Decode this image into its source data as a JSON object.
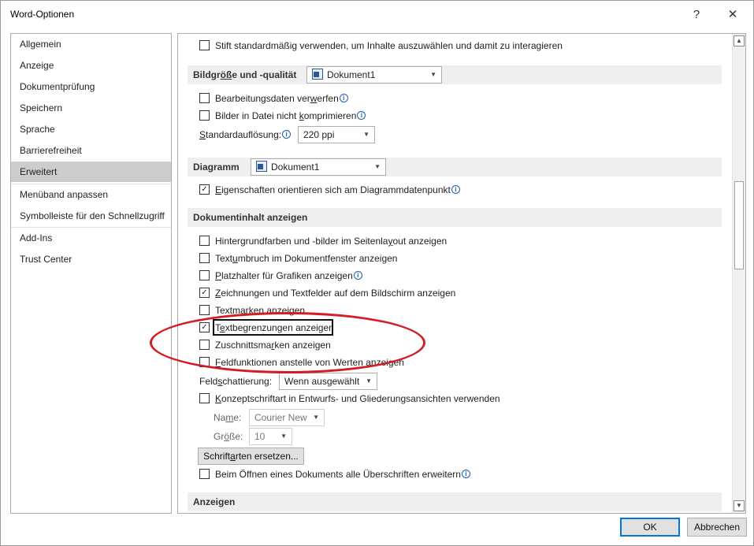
{
  "window": {
    "title": "Word-Optionen",
    "help_glyph": "?",
    "close_glyph": "✕"
  },
  "nav": {
    "items": [
      {
        "label": "Allgemein"
      },
      {
        "label": "Anzeige"
      },
      {
        "label": "Dokumentprüfung"
      },
      {
        "label": "Speichern"
      },
      {
        "label": "Sprache"
      },
      {
        "label": "Barrierefreiheit"
      },
      {
        "label": "Erweitert"
      },
      {
        "label": "Menüband anpassen"
      },
      {
        "label": "Symbolleiste für den Schnellzugriff"
      },
      {
        "label": "Add-Ins"
      },
      {
        "label": "Trust Center"
      }
    ],
    "selected": "Erweitert"
  },
  "content": {
    "top_option": {
      "label": "Stift standardmäßig verwenden, um Inhalte auszuwählen und damit zu interagieren",
      "checked": false
    },
    "image_section": {
      "title_prefix": "Bildgr",
      "title_underlined": "öß",
      "title_suffix": "e und -qualität",
      "doc_value": "Dokument1",
      "options": [
        {
          "pre": "Bearbeitungsdaten ver",
          "u": "w",
          "post": "erfen",
          "checked": false
        },
        {
          "pre": "Bilder in Datei nicht ",
          "u": "k",
          "post": "omprimieren",
          "checked": false
        }
      ],
      "resolution_label_u": "S",
      "resolution_label_rest": "tandardauflösung:",
      "resolution_value": "220 ppi"
    },
    "chart_section": {
      "title": "Diagramm",
      "doc_value": "Dokument1",
      "option": {
        "u": "E",
        "post": "igenschaften orientieren sich am Diagrammdatenpunkt",
        "checked": true
      }
    },
    "display_section": {
      "title": "Dokumentinhalt anzeigen",
      "options": [
        {
          "pre": "Hintergrundfarben und -bilder im Seitenla",
          "u": "y",
          "post": "out anzeigen",
          "checked": false,
          "info": false
        },
        {
          "pre": "Text",
          "u": "u",
          "post": "mbruch im Dokumentfenster anzeigen",
          "checked": false,
          "info": false
        },
        {
          "pre": "",
          "u": "P",
          "post": "latzhalter für Grafiken anzeigen",
          "checked": false,
          "info": true
        },
        {
          "pre": "",
          "u": "Z",
          "post": "eichnungen und Textfelder auf dem Bildschirm anzeigen",
          "checked": true,
          "info": false
        },
        {
          "pre": "Textmar",
          "u": "k",
          "post": "en anzeigen",
          "checked": false,
          "info": false
        },
        {
          "pre": "T",
          "u": "e",
          "post": "xtbegrenzungen anzeigen",
          "checked": true,
          "info": false
        },
        {
          "pre": "Zuschnittsma",
          "u": "r",
          "post": "ken anzeigen",
          "checked": false,
          "info": false
        },
        {
          "pre": "",
          "u": "F",
          "post": "eldfunktionen anstelle von Werten anzeigen",
          "checked": false,
          "info": false
        }
      ],
      "shading_label_pre": "Feld",
      "shading_label_u": "s",
      "shading_label_post": "chattierung:",
      "shading_value": "Wenn ausgewählt",
      "draft_font": {
        "pre": "",
        "u": "K",
        "post": "onzeptschriftart in Entwurfs- und Gliederungsansichten verwenden",
        "checked": false
      },
      "name_label_pre": "Na",
      "name_label_u": "m",
      "name_label_post": "e:",
      "name_value": "Courier New",
      "size_label_pre": "Gr",
      "size_label_u": "ö",
      "size_label_post": "ße:",
      "size_value": "10",
      "replace_fonts_pre": "Schrift",
      "replace_fonts_u": "a",
      "replace_fonts_post": "rten ersetzen...",
      "expand_headings": {
        "label": "Beim Öffnen eines Dokuments alle Überschriften erweitern",
        "checked": false
      }
    },
    "view_section": {
      "title": "Anzeigen"
    }
  },
  "footer": {
    "ok": "OK",
    "cancel": "Abbrechen"
  },
  "colors": {
    "annotation_ellipse": "#d41c24",
    "selected_nav": "#cdcdcd",
    "section_bg": "#efefef",
    "primary_focus": "#0078d7"
  }
}
